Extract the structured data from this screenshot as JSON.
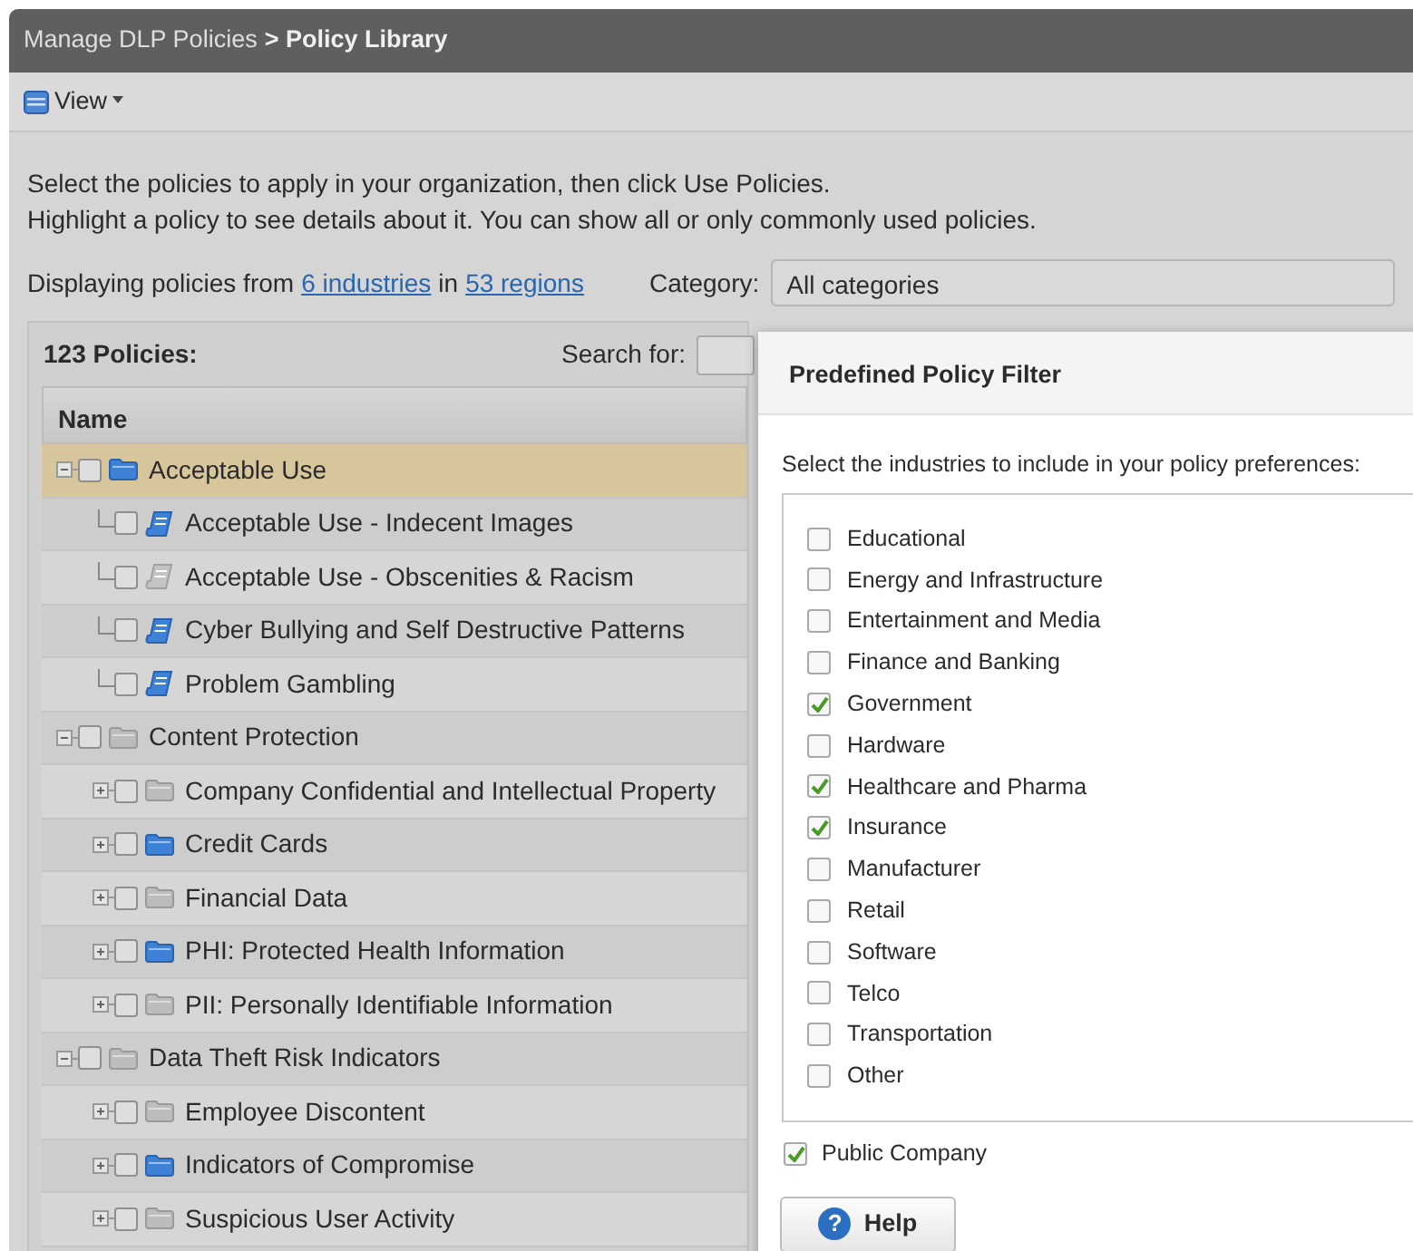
{
  "breadcrumb": {
    "parent": "Manage DLP Policies",
    "current": "> Policy Library"
  },
  "toolbar": {
    "view_menu": "View"
  },
  "intro": [
    "Select the policies to apply in your organization, then click Use Policies.",
    "Highlight a policy to see details about it. You can show all or only commonly used policies."
  ],
  "scope": {
    "prefix": "Displaying policies from",
    "industries_link": "6 industries",
    "middle": "in",
    "regions_link": "53 regions"
  },
  "category": {
    "label": "Category:",
    "value": "All categories"
  },
  "policies": {
    "count_label": "123 Policies:",
    "search_label": "Search for:",
    "columns": [
      "Name"
    ],
    "tree": [
      {
        "label": "Acceptable Use",
        "kind": "folder",
        "active": true,
        "checked": false,
        "selected": true,
        "expanded": true,
        "children": [
          {
            "label": "Acceptable Use - Indecent Images",
            "kind": "policy",
            "active": true,
            "checked": false,
            "selected": false
          },
          {
            "label": "Acceptable Use - Obscenities & Racism",
            "kind": "policy",
            "active": false,
            "checked": false,
            "selected": false
          },
          {
            "label": "Cyber Bullying and Self Destructive Patterns",
            "kind": "policy",
            "active": true,
            "checked": false,
            "selected": false
          },
          {
            "label": "Problem Gambling",
            "kind": "policy",
            "active": true,
            "checked": false,
            "selected": false
          }
        ]
      },
      {
        "label": "Content Protection",
        "kind": "folder",
        "active": false,
        "checked": false,
        "selected": false,
        "expanded": true,
        "children": [
          {
            "label": "Company Confidential and Intellectual Property",
            "kind": "folder",
            "active": false,
            "checked": false,
            "selected": false,
            "expanded": false
          },
          {
            "label": "Credit Cards",
            "kind": "folder",
            "active": true,
            "checked": false,
            "selected": false,
            "expanded": false
          },
          {
            "label": "Financial Data",
            "kind": "folder",
            "active": false,
            "checked": false,
            "selected": false,
            "expanded": false
          },
          {
            "label": "PHI: Protected Health Information",
            "kind": "folder",
            "active": true,
            "checked": false,
            "selected": false,
            "expanded": false
          },
          {
            "label": "PII: Personally Identifiable Information",
            "kind": "folder",
            "active": false,
            "checked": false,
            "selected": false,
            "expanded": false
          }
        ]
      },
      {
        "label": "Data Theft Risk Indicators",
        "kind": "folder",
        "active": false,
        "checked": false,
        "selected": false,
        "expanded": true,
        "children": [
          {
            "label": "Employee Discontent",
            "kind": "folder",
            "active": false,
            "checked": false,
            "selected": false,
            "expanded": false
          },
          {
            "label": "Indicators of Compromise",
            "kind": "folder",
            "active": true,
            "checked": false,
            "selected": false,
            "expanded": false
          },
          {
            "label": "Suspicious User Activity",
            "kind": "folder",
            "active": false,
            "checked": false,
            "selected": false,
            "expanded": false
          }
        ]
      }
    ]
  },
  "filter_dialog": {
    "title": "Predefined Policy Filter",
    "prompt": "Select the industries to include in your policy preferences:",
    "industries": [
      {
        "label": "Educational",
        "checked": false
      },
      {
        "label": "Energy and Infrastructure",
        "checked": false
      },
      {
        "label": "Entertainment and Media",
        "checked": false
      },
      {
        "label": "Finance and Banking",
        "checked": false
      },
      {
        "label": "Government",
        "checked": true
      },
      {
        "label": "Hardware",
        "checked": false
      },
      {
        "label": "Healthcare and Pharma",
        "checked": true
      },
      {
        "label": "Insurance",
        "checked": true
      },
      {
        "label": "Manufacturer",
        "checked": false
      },
      {
        "label": "Retail",
        "checked": false
      },
      {
        "label": "Software",
        "checked": false
      },
      {
        "label": "Telco",
        "checked": false
      },
      {
        "label": "Transportation",
        "checked": false
      },
      {
        "label": "Other",
        "checked": false
      }
    ],
    "public_company": {
      "label": "Public Company",
      "checked": true
    },
    "help_button": {
      "icon": "?",
      "label": "Help"
    }
  }
}
